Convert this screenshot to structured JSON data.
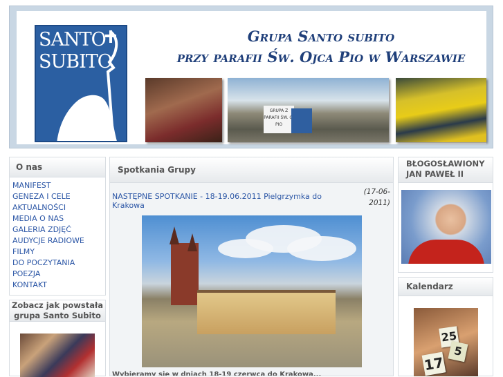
{
  "header": {
    "logo_line1": "SANTO",
    "logo_line2": "SUBITO",
    "title_line1": "Grupa Santo subito",
    "title_line2": "przy parafii Św. Ojca Pio w Warszawie",
    "photo_sign_text": "GRUPA Z PARAFII ŚW. O. PIO"
  },
  "left": {
    "menu_title": "O nas",
    "menu_items": [
      "MANIFEST",
      "GENEZA I CELE",
      "AKTUALNOŚCI",
      "MEDIA O NAS",
      "GALERIA ZDJĘĆ",
      "AUDYCJE RADIOWE",
      "FILMY",
      "DO POCZYTANIA",
      "POEZJA",
      "KONTAKT"
    ],
    "box2_title": "Zobacz jak powstała grupa Santo Subito"
  },
  "center": {
    "section_title": "Spotkania Grupy",
    "post_title": "NASTĘPNE SPOTKANIE - 18-19.06.2011 Pielgrzymka do Krakowa",
    "post_date": "(17-06-2011)",
    "post_footer": "Wybieramy się w dniach 18-19 czerwca do Krakowa..."
  },
  "right": {
    "box1_title": "Błogosławiony Jan Paweł II",
    "box2_title": "Kalendarz",
    "calendar_numbers": [
      "25",
      "5",
      "17"
    ]
  }
}
